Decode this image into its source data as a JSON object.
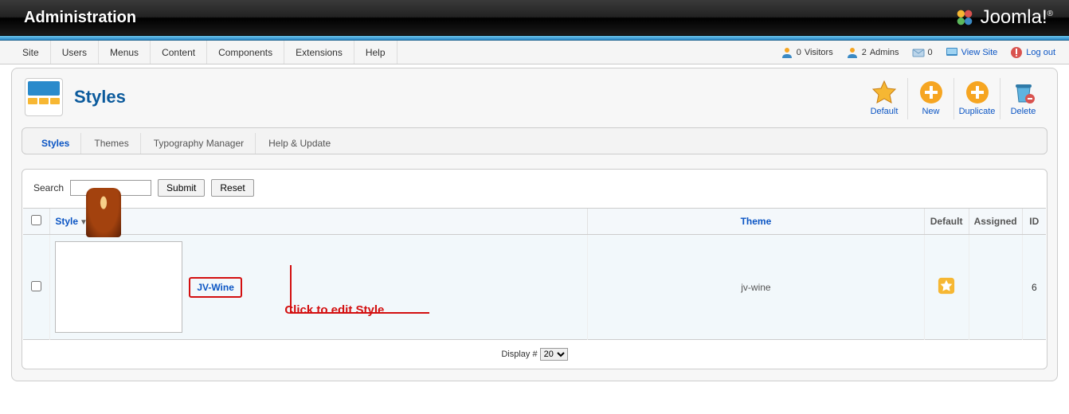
{
  "header": {
    "title": "Administration",
    "logo_text": "Joomla!"
  },
  "menu": [
    "Site",
    "Users",
    "Menus",
    "Content",
    "Components",
    "Extensions",
    "Help"
  ],
  "status": {
    "visitors_count": "0",
    "visitors_label": "Visitors",
    "admins_count": "2",
    "admins_label": "Admins",
    "messages_count": "0",
    "view_site": "View Site",
    "logout": "Log out"
  },
  "page": {
    "title": "Styles"
  },
  "toolbar": [
    {
      "name": "default",
      "label": "Default"
    },
    {
      "name": "new",
      "label": "New"
    },
    {
      "name": "duplicate",
      "label": "Duplicate"
    },
    {
      "name": "delete",
      "label": "Delete"
    }
  ],
  "subtabs": [
    "Styles",
    "Themes",
    "Typography Manager",
    "Help & Update"
  ],
  "search": {
    "label": "Search",
    "submit": "Submit",
    "reset": "Reset"
  },
  "table": {
    "headers": {
      "style": "Style",
      "theme": "Theme",
      "default": "Default",
      "assigned": "Assigned",
      "id": "ID"
    },
    "rows": [
      {
        "style": "JV-Wine",
        "theme": "jv-wine",
        "default": true,
        "assigned": "",
        "id": "6"
      }
    ]
  },
  "annotation": "Click to edit Style",
  "display": {
    "label": "Display #",
    "value": "20"
  }
}
